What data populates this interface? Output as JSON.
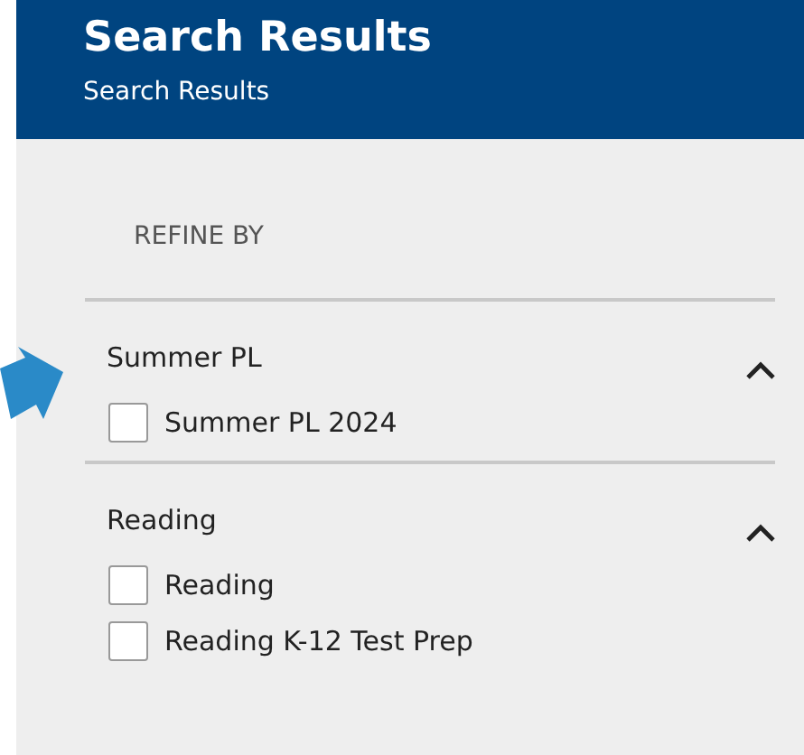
{
  "header": {
    "title": "Search Results",
    "subtitle": "Search Results"
  },
  "refine_label": "REFINE BY",
  "groups": [
    {
      "title": "Summer PL",
      "expanded": true,
      "options": [
        {
          "label": "Summer PL 2024",
          "checked": false
        }
      ]
    },
    {
      "title": "Reading",
      "expanded": true,
      "options": [
        {
          "label": "Reading",
          "checked": false
        },
        {
          "label": "Reading K-12 Test Prep",
          "checked": false
        }
      ]
    }
  ]
}
